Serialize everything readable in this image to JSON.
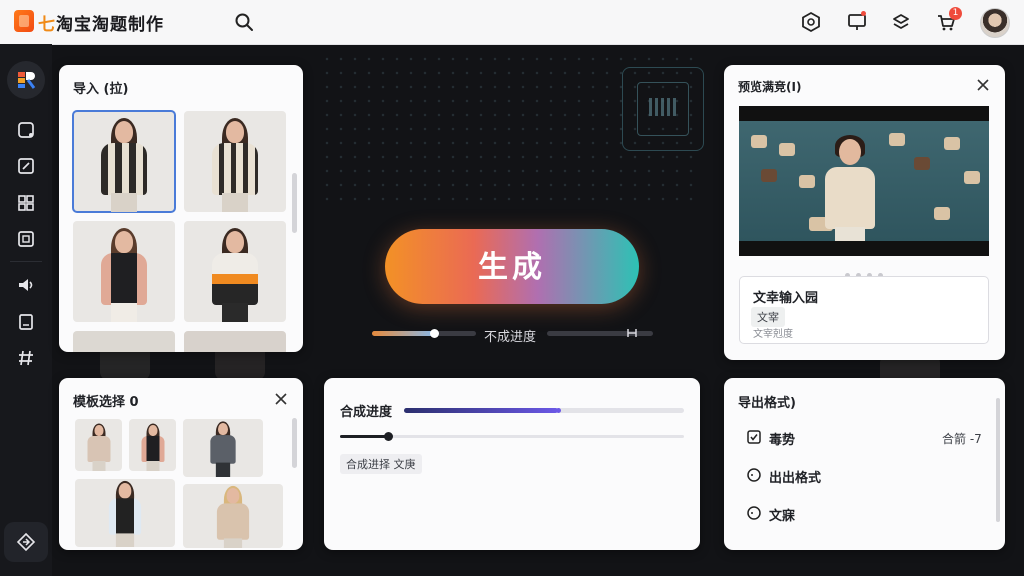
{
  "app": {
    "title_prefix": "七",
    "title_rest": "淘宝淘题制作"
  },
  "header": {
    "notification_count": "1"
  },
  "import_panel": {
    "title": "导入 (拉)"
  },
  "template_panel": {
    "title": "模板选择 0"
  },
  "center": {
    "generate_label": "生成",
    "progress_label": "不成进度",
    "progress_fraction": 0.6
  },
  "synthesis_panel": {
    "title": "合成进度",
    "tag": "合成进择 文庚",
    "progress_fraction": 0.55,
    "slider_fraction": 0.14
  },
  "preview_panel": {
    "title": "预览满竞(I)",
    "text_box_title": "文幸输入园",
    "text_box_tag": "文宰",
    "text_box_hint": "文宰剋度"
  },
  "export_panel": {
    "title": "导出格式)",
    "options": [
      {
        "label": "毒势",
        "value": "合箭 -7"
      },
      {
        "label": "出出格式"
      },
      {
        "label": "文寐"
      }
    ]
  },
  "colors": {
    "accent_orange": "#f39126",
    "accent_teal": "#2dc2b4",
    "progress_purple": "#6b58e6",
    "selection_blue": "#4a7bd8"
  }
}
